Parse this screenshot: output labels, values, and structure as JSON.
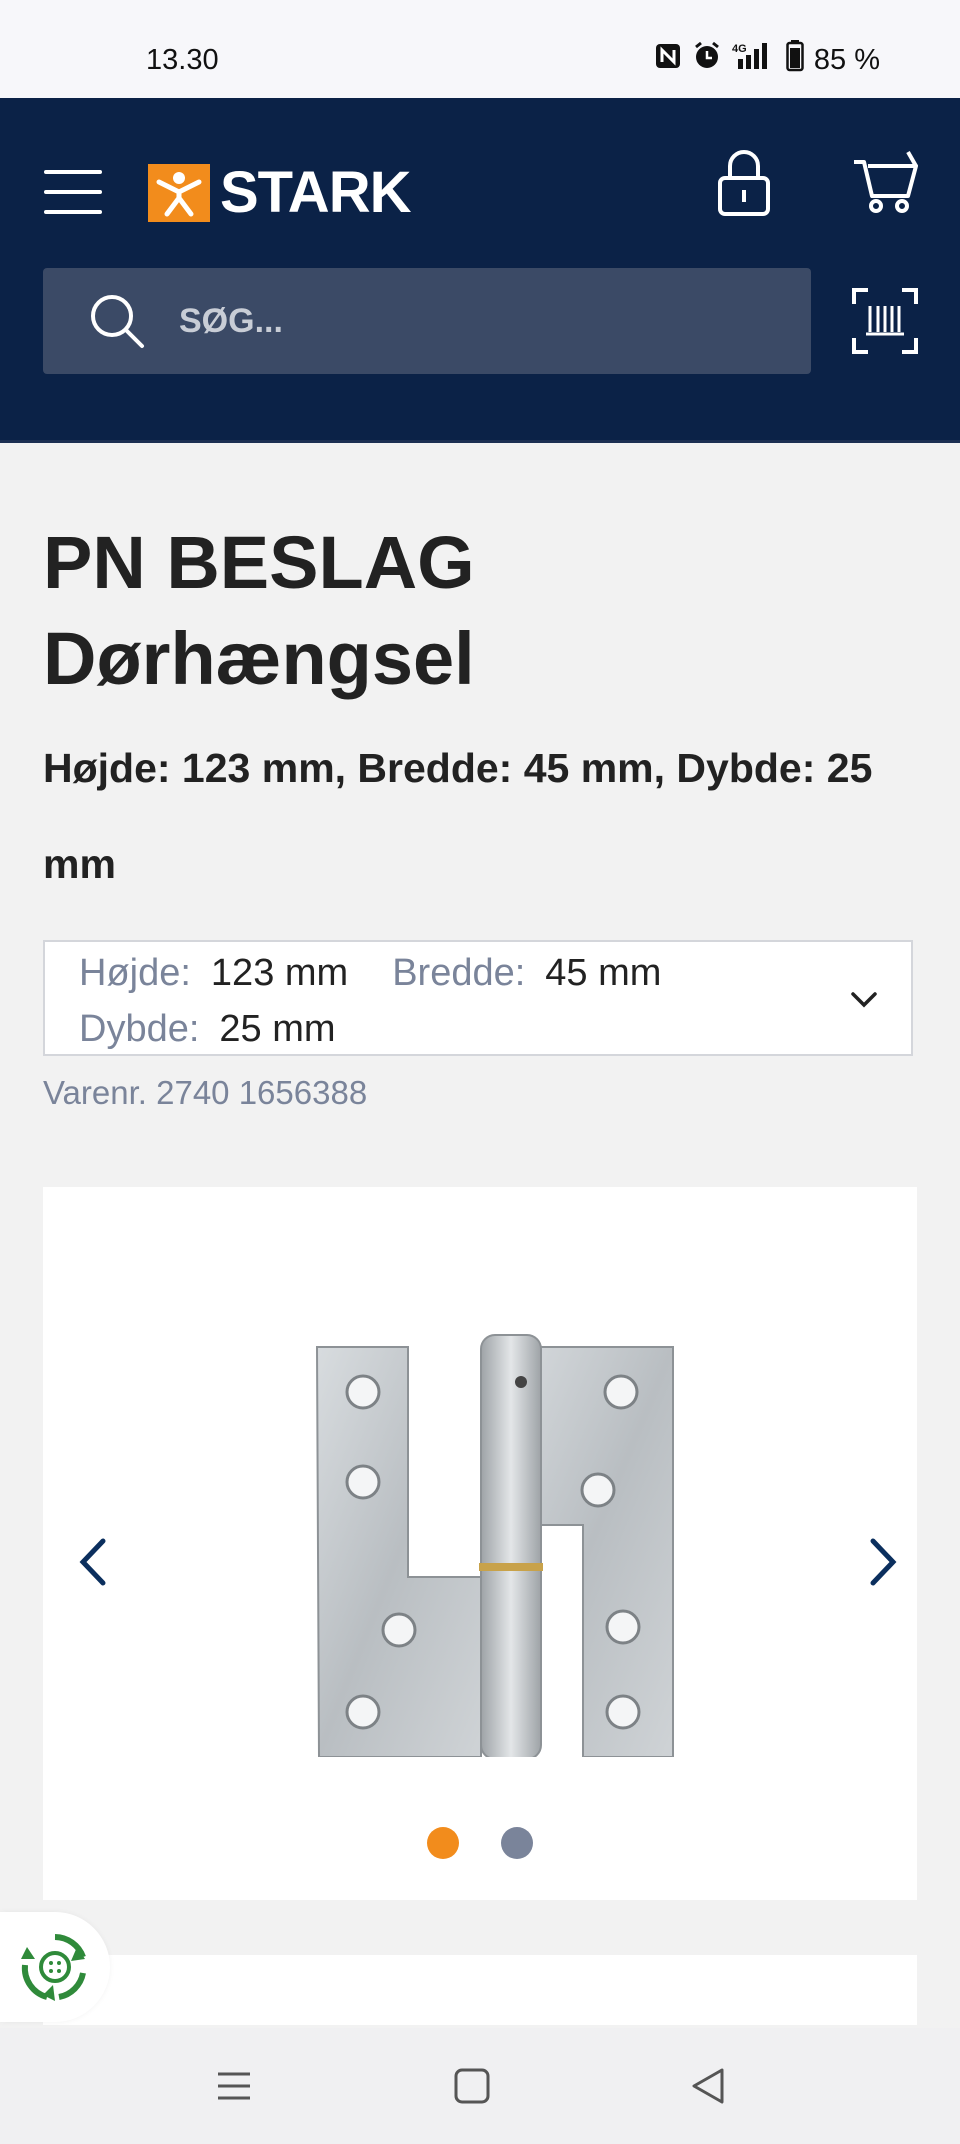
{
  "status_bar": {
    "time": "13.30",
    "icons": [
      "nfc-icon",
      "alarm-icon",
      "signal-4g-icon",
      "battery-icon"
    ],
    "network": "4G",
    "battery": "85 %"
  },
  "header": {
    "logo_text": "STARK",
    "search_placeholder": "SØG...",
    "colors": {
      "background": "#0b2247",
      "search_bg": "#3b4a66",
      "brand_orange": "#f28c1c"
    }
  },
  "product": {
    "brand": "PN BESLAG",
    "name": "Dørhængsel",
    "subtitle": "Højde: 123 mm, Bredde: 45 mm, Dybde: 25 mm",
    "variant": {
      "height_label": "Højde:",
      "height_value": "123 mm",
      "width_label": "Bredde:",
      "width_value": "45 mm",
      "depth_label": "Dybde:",
      "depth_value": "25 mm"
    },
    "sku": "Varenr. 2740 1656388"
  },
  "gallery": {
    "image_count": 2,
    "active_index": 0,
    "dot_colors": {
      "active": "#f28c1c",
      "inactive": "#7a849a"
    }
  },
  "android_nav": [
    "menu-icon",
    "home-icon",
    "back-icon"
  ]
}
